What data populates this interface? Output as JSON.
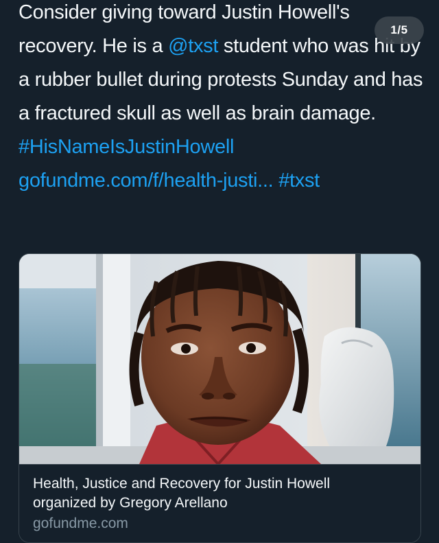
{
  "tweet": {
    "text_before_mention": "Consider giving toward Justin Howell's recovery. He is a ",
    "mention": "@txst",
    "text_after_mention": " student who was hit by a rubber bullet during protests Sunday and has a fractured skull as well as brain damage.",
    "hashtag_1": "#HisNameIsJustinHowell",
    "url_text": "gofundme.com/f/health-justi...",
    "hashtag_2": "#txst"
  },
  "pager": {
    "label": "1/5"
  },
  "card": {
    "title_line_1": "Health, Justice and Recovery for Justin Howell",
    "title_line_2": "organized by Gregory Arellano",
    "domain": "gofundme.com"
  },
  "colors": {
    "background": "#15202b",
    "text": "#f5f8fa",
    "link": "#1da1f2",
    "muted": "#8899a6",
    "border": "#38444d"
  }
}
